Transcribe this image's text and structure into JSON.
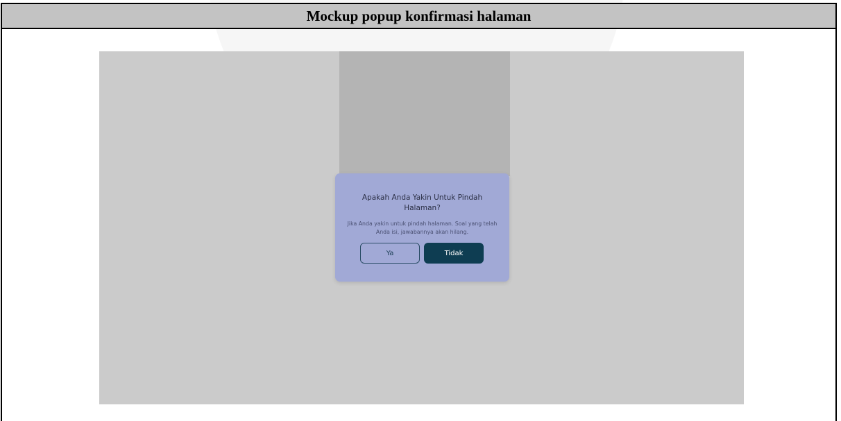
{
  "table": {
    "header_title": "Mockup popup konfirmasi halaman"
  },
  "dialog": {
    "title": "Apakah Anda Yakin Untuk Pindah Halaman?",
    "message": "Jika Anda yakin untuk pindah halaman. Soal yang telah Anda isi, jawabannya akan hilang.",
    "yes_label": "Ya",
    "no_label": "Tidak"
  },
  "colors": {
    "dialog_background": "#a1a9d6",
    "primary_button": "#0e3d52",
    "outline_button_border": "#2a4d66",
    "backdrop": "#cbcbcb"
  }
}
